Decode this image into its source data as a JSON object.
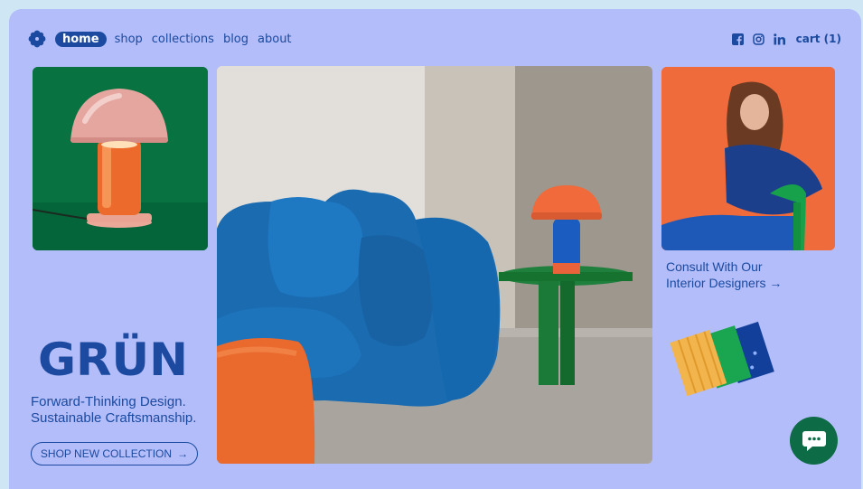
{
  "nav": {
    "links": [
      {
        "label": "home"
      },
      {
        "label": "shop"
      },
      {
        "label": "collections"
      },
      {
        "label": "blog"
      },
      {
        "label": "about"
      }
    ],
    "social_icons": [
      "facebook-icon",
      "instagram-icon",
      "linkedin-icon"
    ],
    "cart_label": "cart (1)"
  },
  "brand": {
    "logo_text": "GRÜN",
    "tagline_line1": "Forward-Thinking Design.",
    "tagline_line2": "Sustainable Craftsmanship.",
    "cta_label": "SHOP NEW COLLECTION"
  },
  "side": {
    "consult_line1": "Consult With Our",
    "consult_line2": "Interior Designers"
  },
  "colors": {
    "page_bg": "#b3bdf9",
    "accent_blue": "#1b4aa0",
    "green": "#066a3d",
    "orange": "#ee6a3a",
    "chat_bg": "#0d6b45"
  }
}
